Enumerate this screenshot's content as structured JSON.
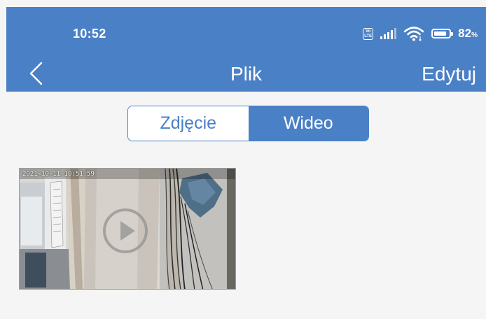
{
  "status": {
    "time": "10:52",
    "volte_label": "Vo LTE",
    "battery_value": "82",
    "battery_unit": "%"
  },
  "nav": {
    "back_icon": "chevron-left-icon",
    "title": "Plik",
    "edit_label": "Edytuj"
  },
  "tabs": [
    {
      "label": "Zdjęcie",
      "active": false
    },
    {
      "label": "Wideo",
      "active": true
    }
  ],
  "videos": [
    {
      "timestamp": "2021-10-11 10:51:59",
      "icon": "play-icon"
    }
  ],
  "colors": {
    "accent": "#4a80c6",
    "background": "#f5f5f5"
  }
}
